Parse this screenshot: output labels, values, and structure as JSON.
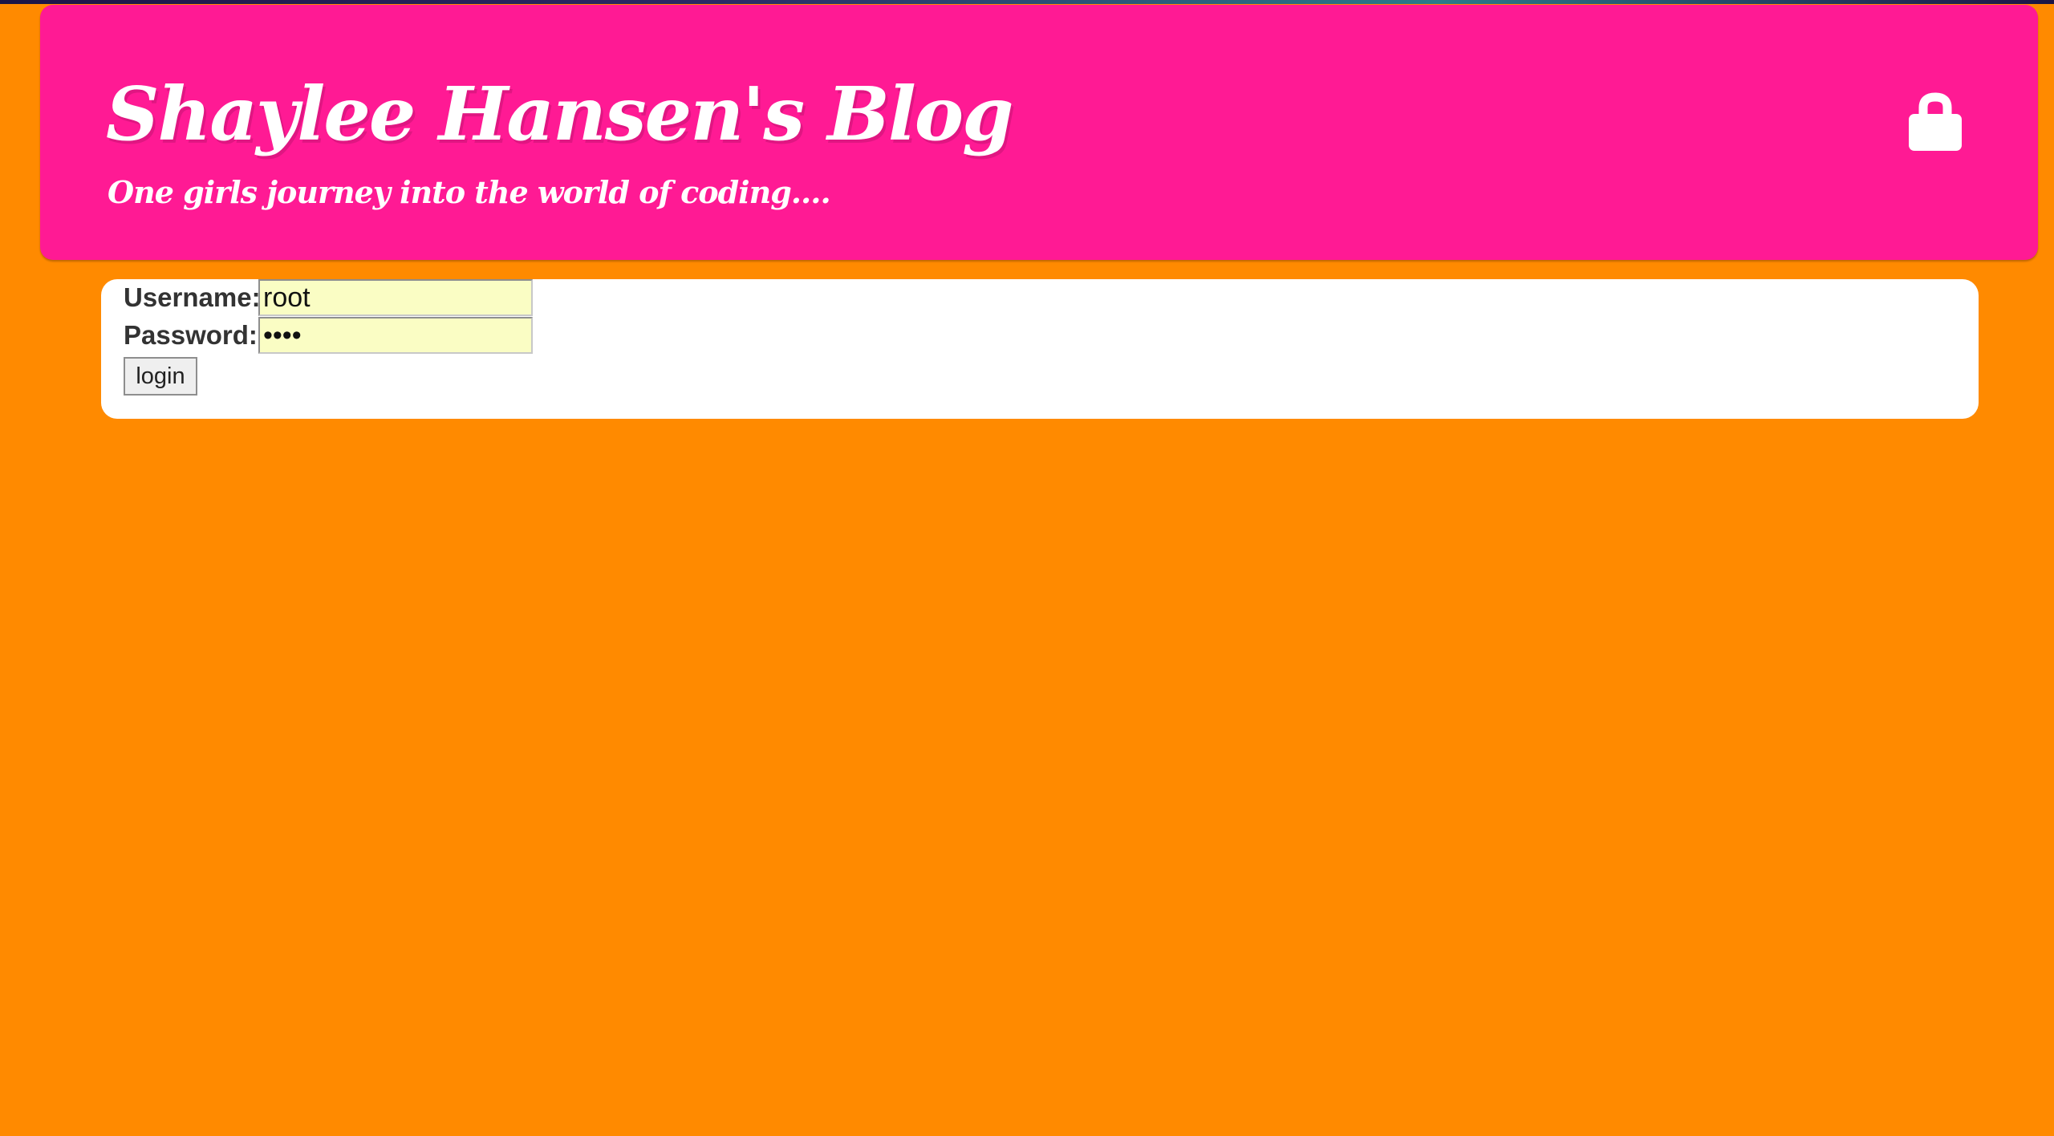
{
  "header": {
    "title": "Shaylee Hansen's Blog",
    "subtitle": "One girls journey into the world of coding....",
    "lock_icon": "lock-icon"
  },
  "login_form": {
    "username_label": "Username:",
    "username_value": "root",
    "password_label": "Password:",
    "password_value": "••••",
    "submit_label": "login"
  },
  "colors": {
    "page_background": "#ff8a00",
    "header_background": "#ff1a94",
    "panel_background": "#ffffff",
    "input_background": "#fafdc4"
  }
}
